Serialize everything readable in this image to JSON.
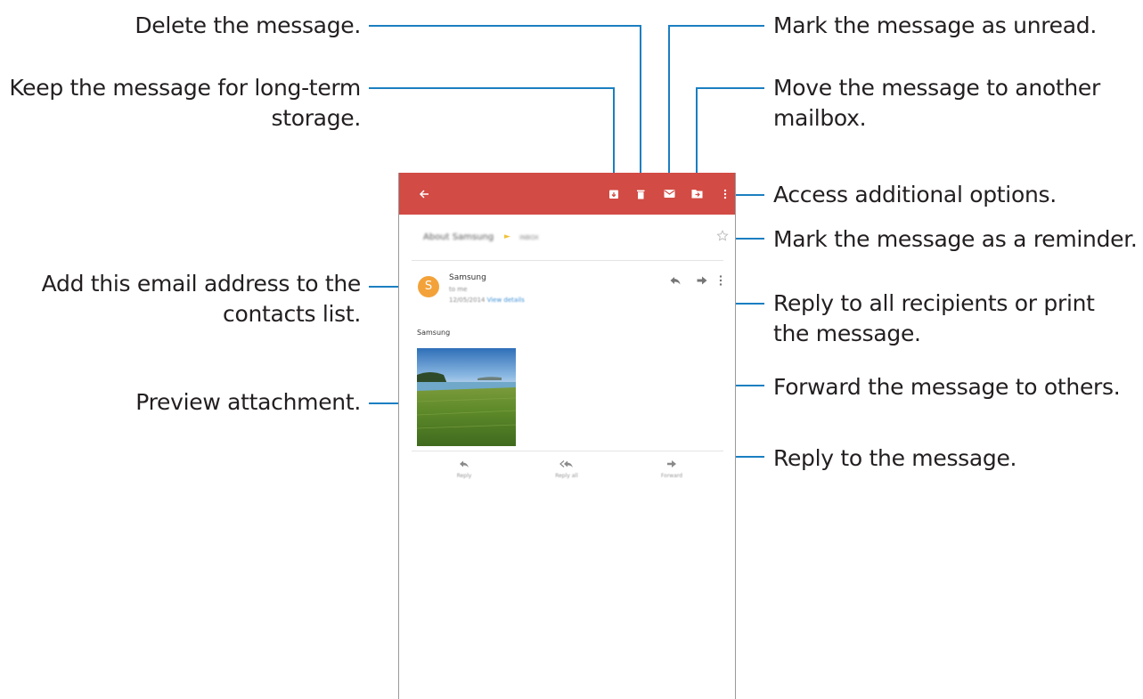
{
  "callouts": {
    "delete": "Delete the message.",
    "keep_line1": "Keep the message for long-term",
    "keep_line2": "storage.",
    "unread": "Mark the message as unread.",
    "move_line1": "Move the message to another",
    "move_line2": "mailbox.",
    "options": "Access additional options.",
    "reminder": "Mark the message as a reminder.",
    "contacts_line1": "Add this email address to the",
    "contacts_line2": "contacts list.",
    "reply_all_line1": "Reply to all recipients or print",
    "reply_all_line2": "the message.",
    "forward": "Forward the message to others.",
    "preview": "Preview attachment.",
    "reply": "Reply to the message."
  },
  "email": {
    "subject": "About Samsung",
    "subject_tag": "INBOX",
    "sender_initial": "S",
    "sender_name": "Samsung",
    "to_line": "to me",
    "date": "12/05/2014",
    "view_details": "View details",
    "body_sender": "Samsung"
  },
  "bottom_actions": {
    "reply": "Reply",
    "reply_all": "Reply all",
    "forward": "Forward"
  },
  "icons": {
    "back": "arrow-left-icon",
    "archive": "archive-icon",
    "delete": "trash-icon",
    "unread": "envelope-icon",
    "move": "folder-move-icon",
    "more": "more-vertical-icon",
    "star": "star-outline-icon",
    "reply": "reply-icon",
    "forward": "forward-icon",
    "reply_all": "reply-all-icon"
  },
  "colors": {
    "appbar": "#d24b44",
    "callout_line": "#1b7fc1",
    "avatar": "#f3a23a",
    "link": "#3b8fd6"
  }
}
